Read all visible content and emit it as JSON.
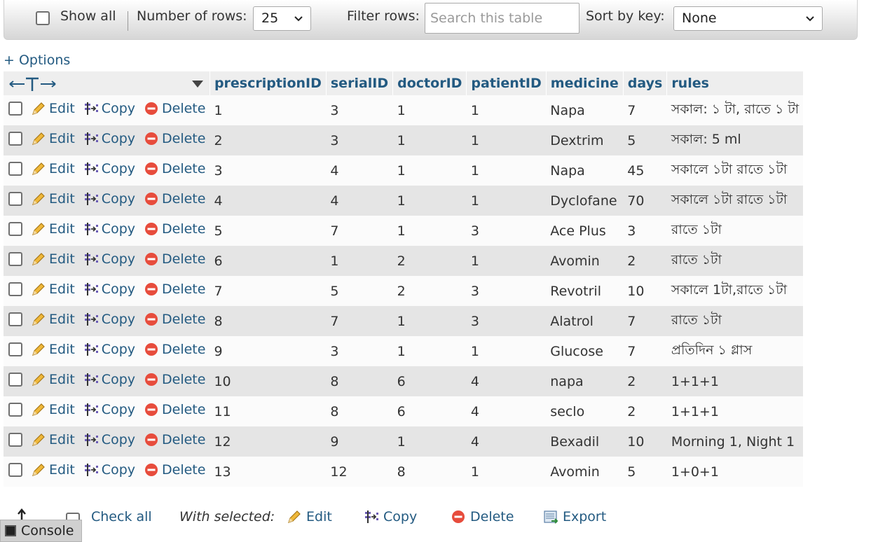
{
  "navbar": {
    "show_all": "Show all",
    "rows_label": "Number of rows:",
    "rows_value": "25",
    "filter_label": "Filter rows:",
    "filter_placeholder": "Search this table",
    "sort_label": "Sort by key:",
    "sort_value": "None"
  },
  "options_link": "+ Options",
  "table": {
    "columns": [
      "prescriptionID",
      "serialID",
      "doctorID",
      "patientID",
      "medicine",
      "days",
      "rules"
    ],
    "actions": {
      "edit": "Edit",
      "copy": "Copy",
      "delete": "Delete"
    },
    "rows": [
      [
        "1",
        "3",
        "1",
        "1",
        "Napa",
        "7",
        "সকাল: ১ টা, রাতে ১ টা"
      ],
      [
        "2",
        "3",
        "1",
        "1",
        "Dextrim",
        "5",
        "সকাল: 5 ml"
      ],
      [
        "3",
        "4",
        "1",
        "1",
        "Napa",
        "45",
        "সকালে ১টা রাতে ১টা"
      ],
      [
        "4",
        "4",
        "1",
        "1",
        "Dyclofane",
        "70",
        "সকালে ১টা রাতে ১টা"
      ],
      [
        "5",
        "7",
        "1",
        "3",
        "Ace Plus",
        "3",
        "রাতে ১টা"
      ],
      [
        "6",
        "1",
        "2",
        "1",
        "Avomin",
        "2",
        "রাতে ১টা"
      ],
      [
        "7",
        "5",
        "2",
        "3",
        "Revotril",
        "10",
        "সকালে 1টা,রাতে ১টা"
      ],
      [
        "8",
        "7",
        "1",
        "3",
        "Alatrol",
        "7",
        "রাতে ১টা"
      ],
      [
        "9",
        "3",
        "1",
        "1",
        "Glucose",
        "7",
        "প্রতিদিন ১ গ্লাস"
      ],
      [
        "10",
        "8",
        "6",
        "4",
        "napa",
        "2",
        "1+1+1"
      ],
      [
        "11",
        "8",
        "6",
        "4",
        "seclo",
        "2",
        "1+1+1"
      ],
      [
        "12",
        "9",
        "1",
        "4",
        "Bexadil",
        "10",
        "Morning 1, Night 1"
      ],
      [
        "13",
        "12",
        "8",
        "1",
        "Avomin",
        "5",
        "1+0+1"
      ]
    ]
  },
  "bottom": {
    "check_all": "Check all",
    "with_selected": "With selected:",
    "edit": "Edit",
    "copy": "Copy",
    "delete": "Delete",
    "export": "Export"
  },
  "console": {
    "label": "Console"
  },
  "colors": {
    "link": "#235a81",
    "delete_red": "#e74c3c",
    "row_alt": "#e5e5e5"
  },
  "icons": [
    "pencil-icon",
    "copy-icon",
    "delete-icon",
    "export-icon",
    "arrow-up-icon",
    "console-icon",
    "chevron-down-icon",
    "column-arrows-icon",
    "sort-triangle-icon"
  ]
}
